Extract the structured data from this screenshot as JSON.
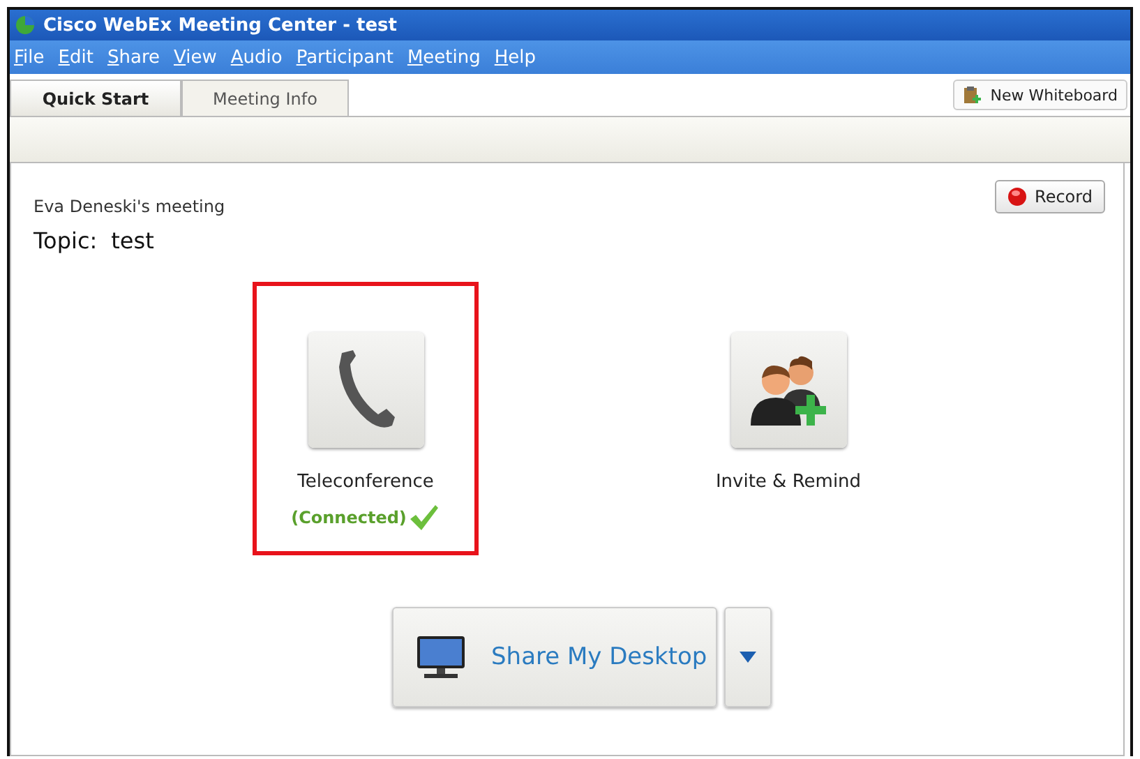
{
  "window": {
    "title": "Cisco WebEx Meeting Center - test"
  },
  "menu": [
    "File",
    "Edit",
    "Share",
    "View",
    "Audio",
    "Participant",
    "Meeting",
    "Help"
  ],
  "tabs": [
    {
      "label": "Quick Start",
      "selected": true
    },
    {
      "label": "Meeting Info",
      "selected": false
    }
  ],
  "new_whiteboard_button": "New Whiteboard",
  "record_button": "Record",
  "meeting_owner": "Eva Deneski's meeting",
  "topic": {
    "label": "Topic:",
    "value": "test"
  },
  "actions": [
    {
      "kind": "phone",
      "label": "Teleconference",
      "status": "(Connected)",
      "highlighted": true
    },
    {
      "kind": "invite",
      "label": "Invite & Remind",
      "highlighted": false
    }
  ],
  "share_button": "Share My Desktop"
}
